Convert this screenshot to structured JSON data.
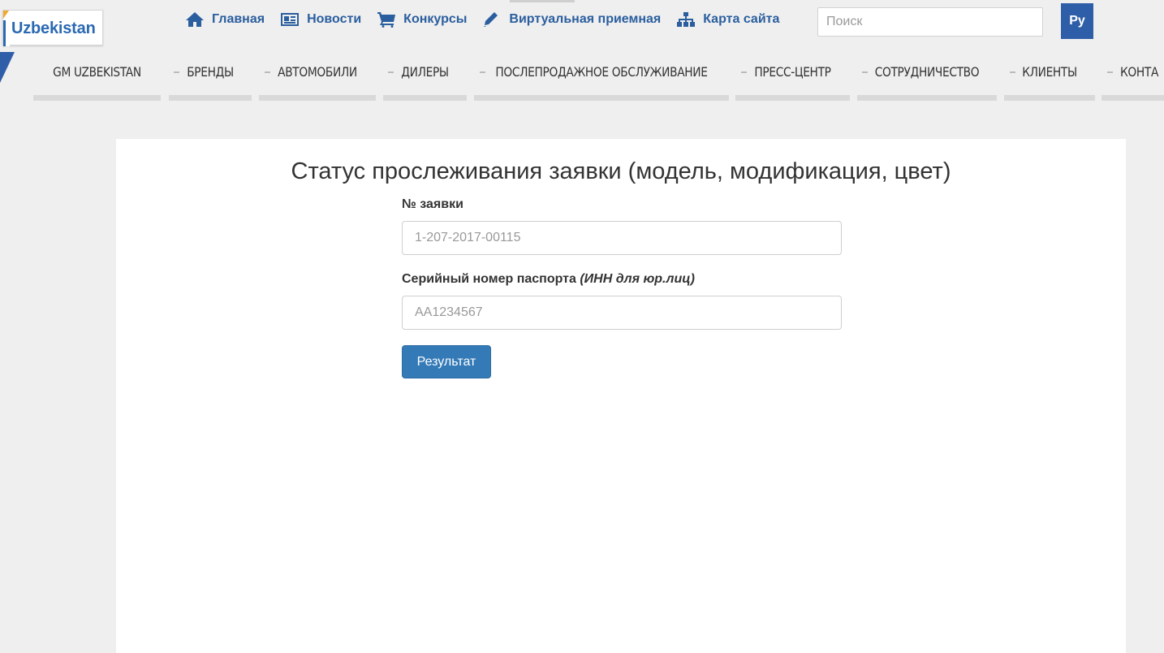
{
  "logo": {
    "text": "Uzbekistan"
  },
  "top_links": [
    {
      "icon": "home-icon",
      "label": "Главная"
    },
    {
      "icon": "newspaper-icon",
      "label": "Новости"
    },
    {
      "icon": "cart-icon",
      "label": "Конкурсы"
    },
    {
      "icon": "pencil-icon",
      "label": "Виртуальная приемная"
    },
    {
      "icon": "sitemap-icon",
      "label": "Карта сайта"
    }
  ],
  "search": {
    "placeholder": "Поиск"
  },
  "language": {
    "label": "Ру"
  },
  "main_nav": [
    {
      "label": "GM UZBEKISTAN"
    },
    {
      "label": "БРЕНДЫ"
    },
    {
      "label": "АВТОМОБИЛИ"
    },
    {
      "label": "ДИЛЕРЫ"
    },
    {
      "label": "ПОСЛЕПРОДАЖНОЕ ОБСЛУЖИВАНИЕ"
    },
    {
      "label": "ПРЕСС-ЦЕНТР"
    },
    {
      "label": "СОТРУДНИЧЕСТВО"
    },
    {
      "label": "КЛИЕНТЫ"
    },
    {
      "label": "КОНТА"
    }
  ],
  "page": {
    "title": "Статус прослеживания заявки (модель, модификация, цвет)",
    "order_label": "№ заявки",
    "order_placeholder": "1-207-2017-00115",
    "passport_label": "Серийный номер паспорта",
    "passport_label_note": "(ИНН для юр.лиц)",
    "passport_placeholder": "AA1234567",
    "submit_label": "Результат"
  },
  "colors": {
    "brand_blue": "#2a5e9e",
    "button_blue": "#337ab7",
    "lang_blue": "#2f5ea8"
  }
}
